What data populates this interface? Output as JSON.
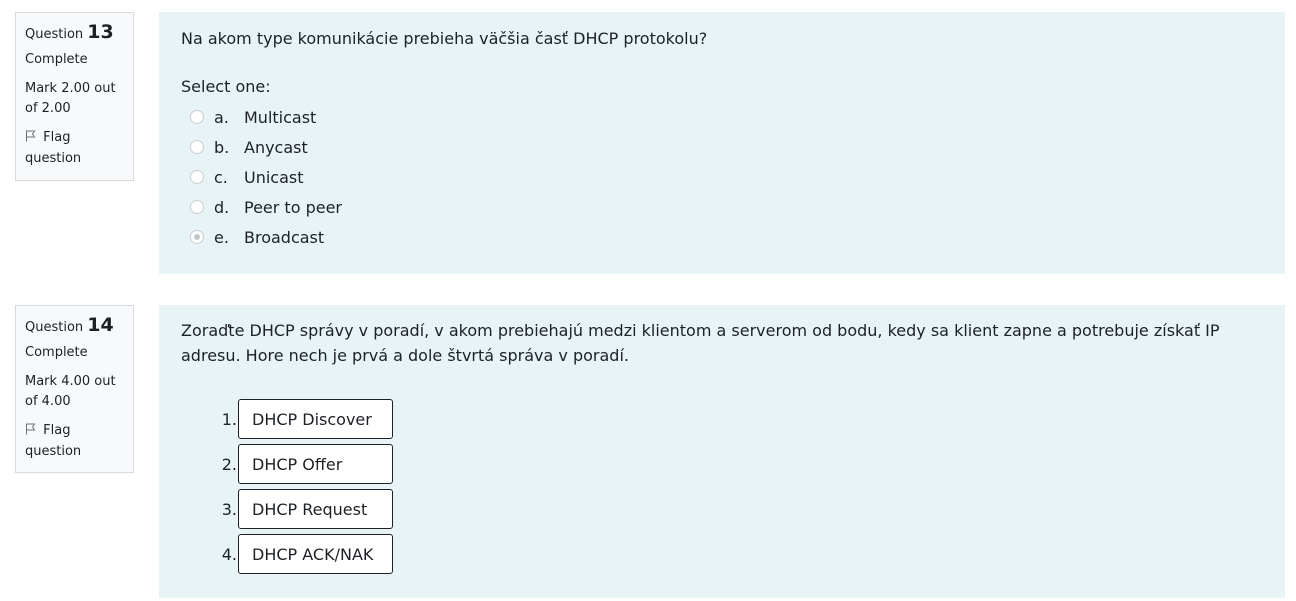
{
  "questions": [
    {
      "label": "Question",
      "number": "13",
      "state": "Complete",
      "grade": "Mark 2.00 out of 2.00",
      "flag_label": "Flag question",
      "text": "Na akom type komunikácie prebieha väčšia časť DHCP protokolu?",
      "prompt": "Select one:",
      "answers": [
        {
          "letter": "a.",
          "label": "Multicast",
          "selected": false
        },
        {
          "letter": "b.",
          "label": "Anycast",
          "selected": false
        },
        {
          "letter": "c.",
          "label": "Unicast",
          "selected": false
        },
        {
          "letter": "d.",
          "label": "Peer to peer",
          "selected": false
        },
        {
          "letter": "e.",
          "label": "Broadcast",
          "selected": true
        }
      ]
    },
    {
      "label": "Question",
      "number": "14",
      "state": "Complete",
      "grade": "Mark 4.00 out of 4.00",
      "flag_label": "Flag question",
      "text": "Zoraďte DHCP správy v poradí, v akom prebiehajú medzi klientom a serverom od bodu, kedy sa klient zapne a potrebuje získať IP adresu. Hore nech je prvá a dole štvrtá správa v poradí.",
      "order_items": [
        {
          "num": "1.",
          "label": "DHCP Discover"
        },
        {
          "num": "2.",
          "label": "DHCP Offer"
        },
        {
          "num": "3.",
          "label": "DHCP Request"
        },
        {
          "num": "4.",
          "label": "DHCP ACK/NAK"
        }
      ]
    }
  ]
}
